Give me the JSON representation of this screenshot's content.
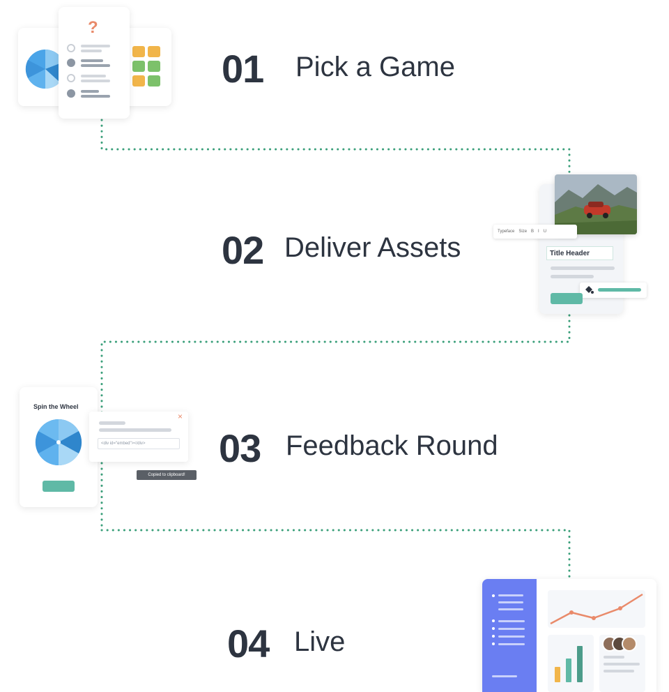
{
  "steps": [
    {
      "number": "01",
      "title": "Pick a Game"
    },
    {
      "number": "02",
      "title": "Deliver Assets"
    },
    {
      "number": "03",
      "title": "Feedback Round"
    },
    {
      "number": "04",
      "title": "Live"
    }
  ],
  "step1_card": {
    "question_mark": "?"
  },
  "step2_card": {
    "toolbar_items": [
      "Typeface",
      "Size",
      "B",
      "I",
      "U"
    ],
    "title_header": "Title Header"
  },
  "step3_card": {
    "wheel_title": "Spin the Wheel",
    "close_symbol": "×",
    "embed_code": "<div id=\"embed\"></div>",
    "toast": "Copied to clipboard!"
  },
  "colors": {
    "dotted_path": "#3a9f7a",
    "teal_accent": "#5fb9a6",
    "dark_text": "#2d3440",
    "sidebar_purple": "#6a7ef2",
    "chart_orange": "#e98a6a",
    "wheel_blue": "#4aa4e8",
    "grid_orange": "#f1b54a",
    "grid_green": "#7cc16a"
  },
  "icons": [
    "question-icon",
    "pie-wheel-icon",
    "paint-bucket-icon",
    "close-icon",
    "menu-icon",
    "line-chart-icon",
    "bar-chart-icon",
    "avatar-icon"
  ]
}
